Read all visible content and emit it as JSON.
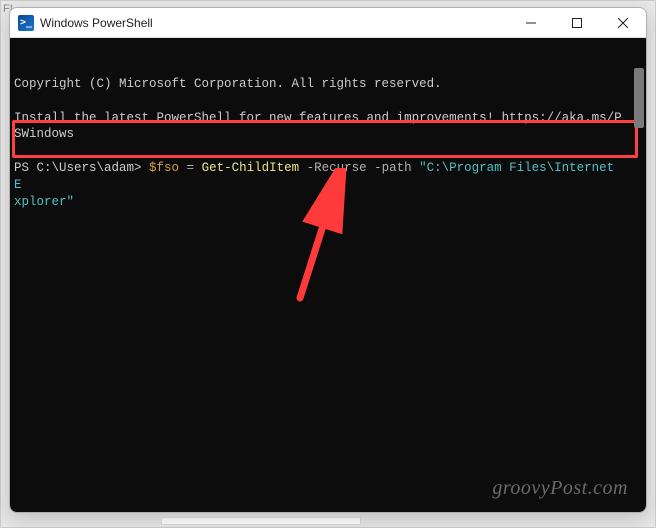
{
  "background": {
    "hint": "F!"
  },
  "window": {
    "title": "Windows PowerShell",
    "icon_glyph": ">_"
  },
  "terminal": {
    "copyright": "Copyright (C) Microsoft Corporation. All rights reserved.",
    "install_msg": "Install the latest PowerShell for new features and improvements! https://aka.ms/PSWindows",
    "prompt": "PS C:\\Users\\adam> ",
    "cmd": {
      "var": "$fso",
      "eq": " = ",
      "cmdlet": "Get-ChildItem",
      "flags": " -Recurse -path ",
      "path_line1": "\"C:\\Program Files\\Internet E",
      "path_line2": "xplorer\""
    }
  },
  "watermark": "groovyPost.com"
}
